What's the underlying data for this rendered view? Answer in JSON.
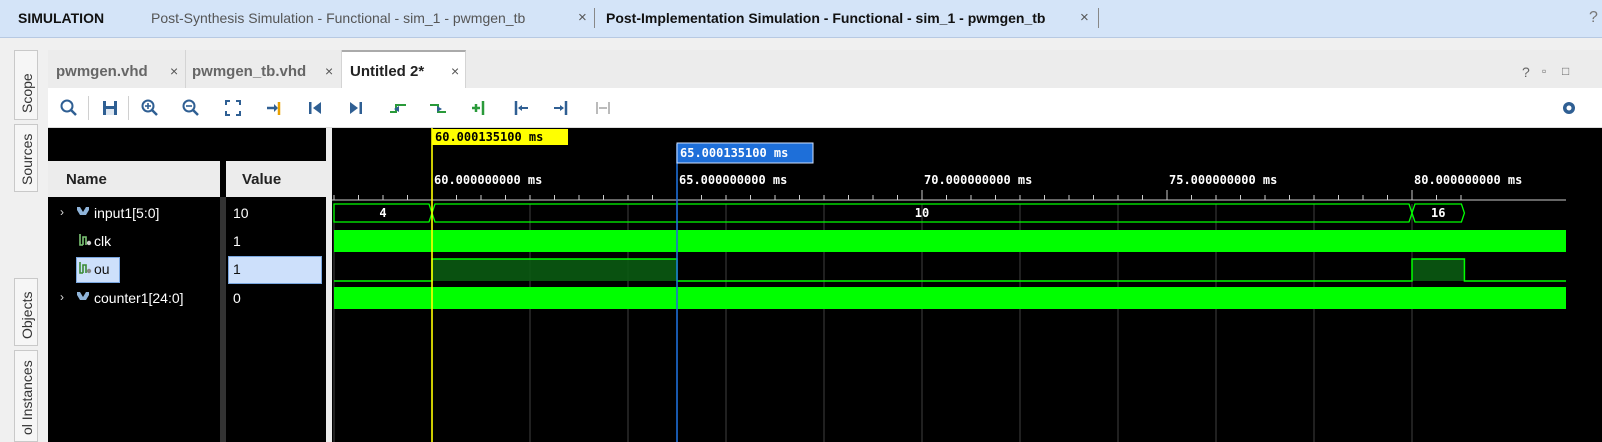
{
  "simbar": {
    "title": "SIMULATION",
    "tabs": [
      {
        "label": "Post-Synthesis Simulation - Functional - sim_1 - pwmgen_tb",
        "active": false
      },
      {
        "label": "Post-Implementation Simulation - Functional - sim_1 - pwmgen_tb",
        "active": true
      }
    ],
    "help_icon": "question-icon"
  },
  "side_tabs": [
    "Scope",
    "Sources",
    "Objects",
    "ol Instances"
  ],
  "editor_tabs": [
    {
      "label": "pwmgen.vhd",
      "active": false
    },
    {
      "label": "pwmgen_tb.vhd",
      "active": false
    },
    {
      "label": "Untitled 2*",
      "active": true
    }
  ],
  "toolbar_icons": [
    "search-icon",
    "save-icon",
    "zoom-in-icon",
    "zoom-out-icon",
    "zoom-fit-icon",
    "goto-cursor-icon",
    "goto-start-icon",
    "goto-end-icon",
    "previous-transition-icon",
    "next-transition-icon",
    "add-marker-icon",
    "previous-marker-icon",
    "next-marker-icon",
    "swap-cursors-icon"
  ],
  "columns": {
    "name": "Name",
    "value": "Value"
  },
  "signals": [
    {
      "name": "input1[5:0]",
      "value": "10",
      "type": "bus",
      "expandable": true,
      "selected": false
    },
    {
      "name": "clk",
      "value": "1",
      "type": "bit",
      "expandable": false,
      "selected": false
    },
    {
      "name": "ou",
      "value": "1",
      "type": "bit",
      "expandable": false,
      "selected": true
    },
    {
      "name": "counter1[24:0]",
      "value": "0",
      "type": "bus",
      "expandable": true,
      "selected": false
    }
  ],
  "waveform": {
    "primary_cursor": {
      "label": "60.000135100 ms",
      "time_ms": 60.0001351,
      "color": "#ffff00"
    },
    "secondary_cursor": {
      "label": "65.000135100 ms",
      "time_ms": 65.0001351,
      "color": "#1e6fd9"
    },
    "time_axis": {
      "start_ms": 58.0,
      "end_ms": 81.07,
      "major_ticks": [
        {
          "time_ms": 60,
          "label": "60.000000000 ms"
        },
        {
          "time_ms": 65,
          "label": "65.000000000 ms"
        },
        {
          "time_ms": 70,
          "label": "70.000000000 ms"
        },
        {
          "time_ms": 75,
          "label": "75.000000000 ms"
        },
        {
          "time_ms": 80,
          "label": "80.000000000 ms"
        }
      ],
      "minor_tick_ms": 0.5,
      "grid_ms": 2
    },
    "bus_segments": [
      {
        "from_ms": 58.0,
        "to_ms": 60.0,
        "value": "4"
      },
      {
        "from_ms": 60.0,
        "to_ms": 80.0,
        "value": "10"
      },
      {
        "from_ms": 80.0,
        "to_ms": 81.07,
        "value": "16"
      }
    ],
    "ou_high_intervals": [
      [
        60.0,
        65.0
      ],
      [
        80.0,
        81.07
      ]
    ],
    "wave_color": "#00ff00"
  }
}
